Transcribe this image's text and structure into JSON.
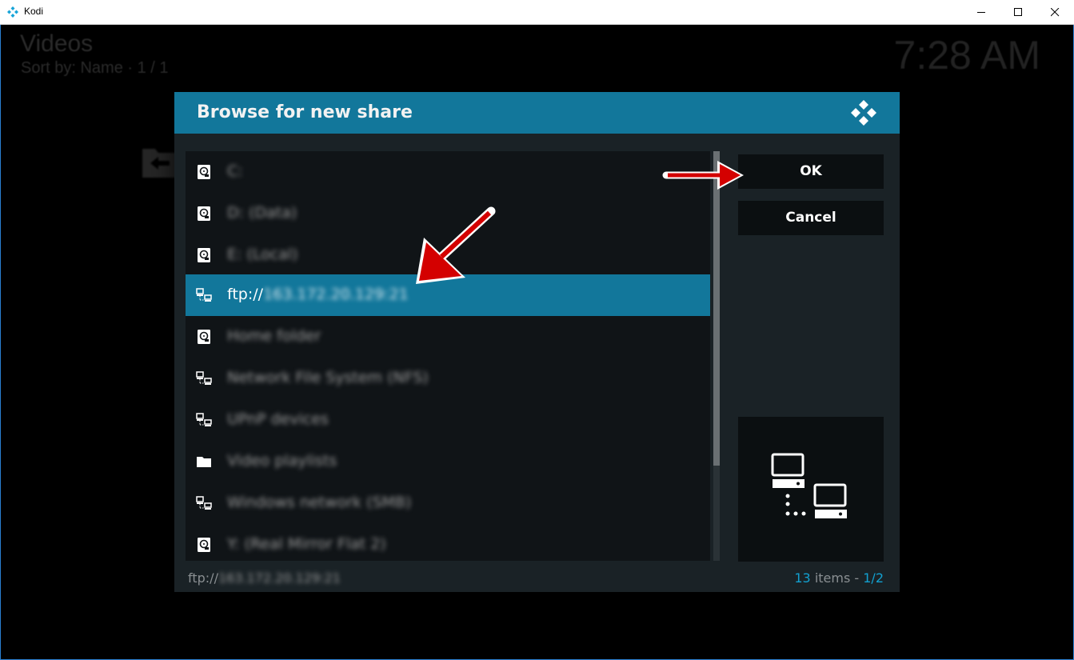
{
  "window": {
    "title": "Kodi",
    "icons": {
      "app": "kodi-icon",
      "minimize": "minimize-icon",
      "maximize": "maximize-icon",
      "close": "close-icon"
    }
  },
  "background": {
    "title": "Videos",
    "sort_text": "Sort by: Name  ·  1 / 1",
    "clock": "7:28 AM"
  },
  "dialog": {
    "title": "Browse for new share",
    "items": [
      {
        "label": "C:",
        "icon": "harddisk-icon",
        "blurred": true
      },
      {
        "label": "D: (Data)",
        "icon": "harddisk-icon",
        "blurred": true
      },
      {
        "label": "E: (Local)",
        "icon": "harddisk-icon",
        "blurred": true
      },
      {
        "label_prefix": "ftp://",
        "label": "163.172.20.129:21",
        "icon": "network-icon",
        "blurred": true,
        "focused": true
      },
      {
        "label": "Home folder",
        "icon": "harddisk-icon",
        "blurred": true
      },
      {
        "label": "Network File System (NFS)",
        "icon": "network-icon",
        "blurred": true
      },
      {
        "label": "UPnP devices",
        "icon": "network-icon",
        "blurred": true
      },
      {
        "label": "Video playlists",
        "icon": "folder-icon",
        "blurred": true
      },
      {
        "label": "Windows network (SMB)",
        "icon": "network-icon",
        "blurred": true
      },
      {
        "label": "Y: (Real Mirror Flat 2)",
        "icon": "harddisk-icon",
        "blurred": true
      }
    ],
    "buttons": {
      "ok": "OK",
      "cancel": "Cancel"
    },
    "footer": {
      "path_prefix": "ftp://",
      "path": "163.172.20.129:21",
      "count": "13",
      "items_word": " items - ",
      "page": "1/2"
    },
    "colors": {
      "header": "#12779b",
      "focus": "#12779b",
      "accent": "#12a0d0"
    }
  },
  "annotations": {
    "arrow_color": "#d40000"
  }
}
